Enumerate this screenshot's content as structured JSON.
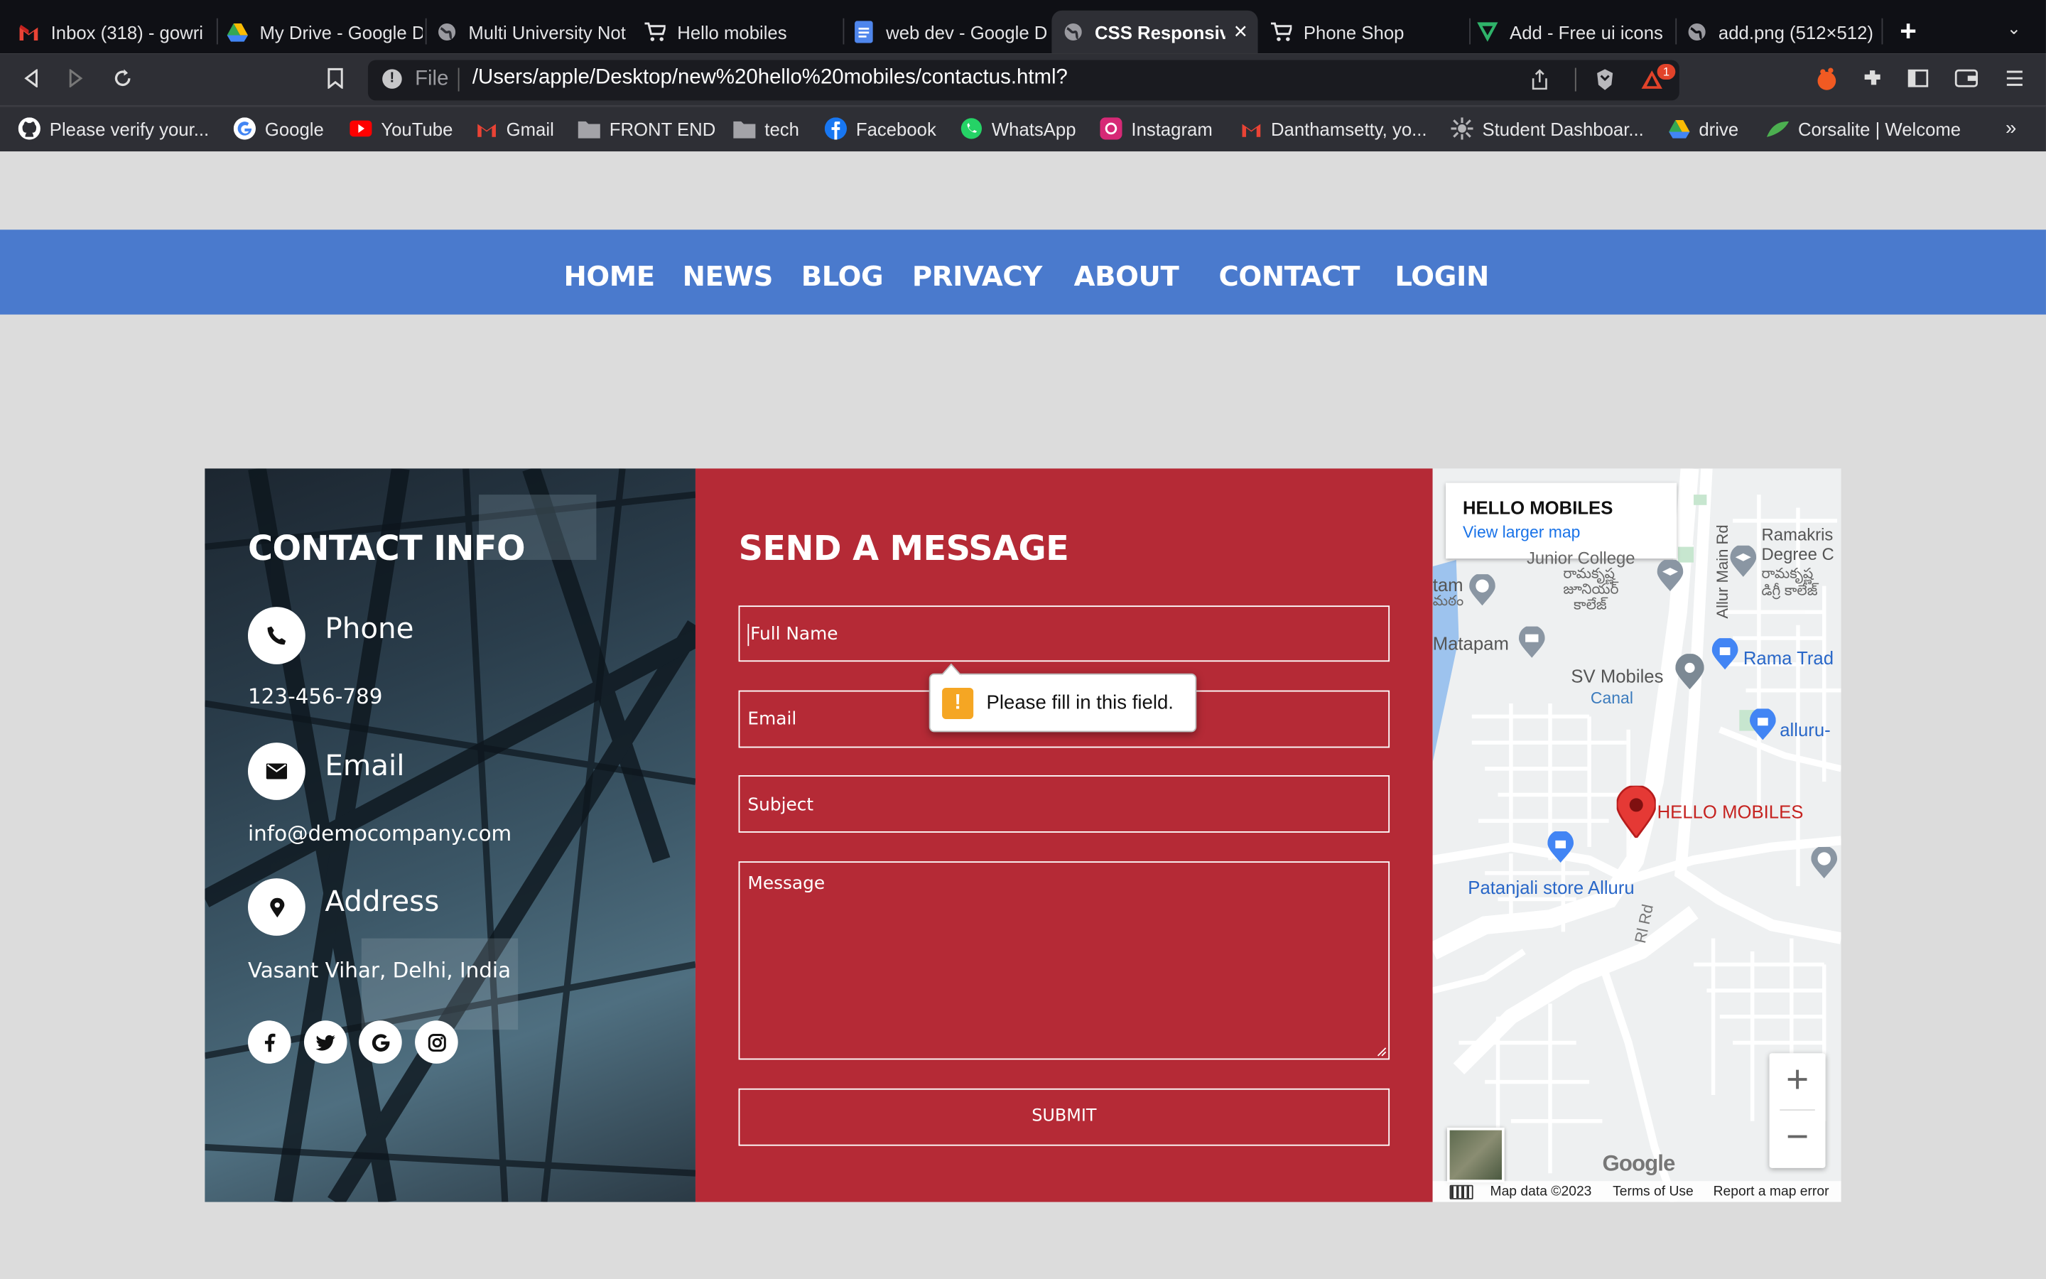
{
  "browser": {
    "tabs": [
      {
        "title": "Inbox (318) - gowri",
        "icon": "gmail-icon"
      },
      {
        "title": "My Drive - Google D",
        "icon": "google-drive-icon"
      },
      {
        "title": "Multi University Not",
        "icon": "globe-icon"
      },
      {
        "title": "Hello mobiles",
        "icon": "cart-icon"
      },
      {
        "title": "web dev - Google D",
        "icon": "google-docs-icon"
      },
      {
        "title": "CSS Responsiv",
        "icon": "globe-icon",
        "active": true
      },
      {
        "title": "Phone Shop",
        "icon": "cart-icon"
      },
      {
        "title": "Add - Free ui icons",
        "icon": "tag-icon"
      },
      {
        "title": "add.png (512×512)",
        "icon": "globe-icon"
      }
    ],
    "url_scheme": "File",
    "url": "/Users/apple/Desktop/new%20hello%20mobiles/contactus.html?",
    "shield_badge": "1",
    "bookmarks": [
      {
        "label": "Please verify your...",
        "icon": "github-icon"
      },
      {
        "label": "Google",
        "icon": "google-icon"
      },
      {
        "label": "YouTube",
        "icon": "youtube-icon"
      },
      {
        "label": "Gmail",
        "icon": "gmail-icon"
      },
      {
        "label": "FRONT END",
        "icon": "folder-icon"
      },
      {
        "label": "tech",
        "icon": "folder-icon"
      },
      {
        "label": "Facebook",
        "icon": "facebook-icon"
      },
      {
        "label": "WhatsApp",
        "icon": "whatsapp-icon"
      },
      {
        "label": "Instagram",
        "icon": "instagram-icon"
      },
      {
        "label": "Danthamsetty, yo...",
        "icon": "gmail-icon"
      },
      {
        "label": "Student Dashboar...",
        "icon": "settings-icon"
      },
      {
        "label": "drive",
        "icon": "google-drive-icon"
      },
      {
        "label": "Corsalite | Welcome",
        "icon": "leaf-icon"
      }
    ],
    "overflow_glyph": "»"
  },
  "nav": [
    "HOME",
    "NEWS",
    "BLOG",
    "PRIVACY",
    "ABOUT",
    "CONTACT",
    "LOGIN"
  ],
  "contact_info": {
    "title": "CONTACT INFO",
    "phone_label": "Phone",
    "phone": "123-456-789",
    "email_label": "Email",
    "email": "info@democompany.com",
    "address_label": "Address",
    "address": "Vasant Vihar, Delhi, India",
    "social": [
      "f",
      "t",
      "G",
      "ig"
    ]
  },
  "form": {
    "title": "SEND A MESSAGE",
    "fullname_placeholder": "Full Name",
    "email_placeholder": "Email",
    "subject_placeholder": "Subject",
    "message_placeholder": "Message",
    "submit": "SUBMIT",
    "validation": "Please fill in this field."
  },
  "map": {
    "place": "HELLO MOBILES",
    "view_larger": "View larger map",
    "labels": [
      "Ramakris",
      "Degree C",
      "రామకృష్ణ",
      "డిగ్రీ కాలేజ్",
      "Junior College",
      "రామకృష్ణ",
      "జూనియర్",
      "కాలేజ్",
      "Allur Main Rd",
      "tam",
      "మఠం",
      "Matapam",
      "Rama Trad",
      "SV Mobiles",
      "Canal",
      "alluru-",
      "HELLO MOBILES",
      "Patanjali store Alluru",
      "Rl Rd"
    ],
    "zoom_in": "+",
    "zoom_out": "−",
    "google": "Google",
    "map_data": "Map data ©2023",
    "terms": "Terms of Use",
    "report": "Report a map error"
  },
  "colors": {
    "nav": "#4a7acd",
    "form_bg": "#b52a36",
    "page_bg": "#dcdcdc"
  }
}
